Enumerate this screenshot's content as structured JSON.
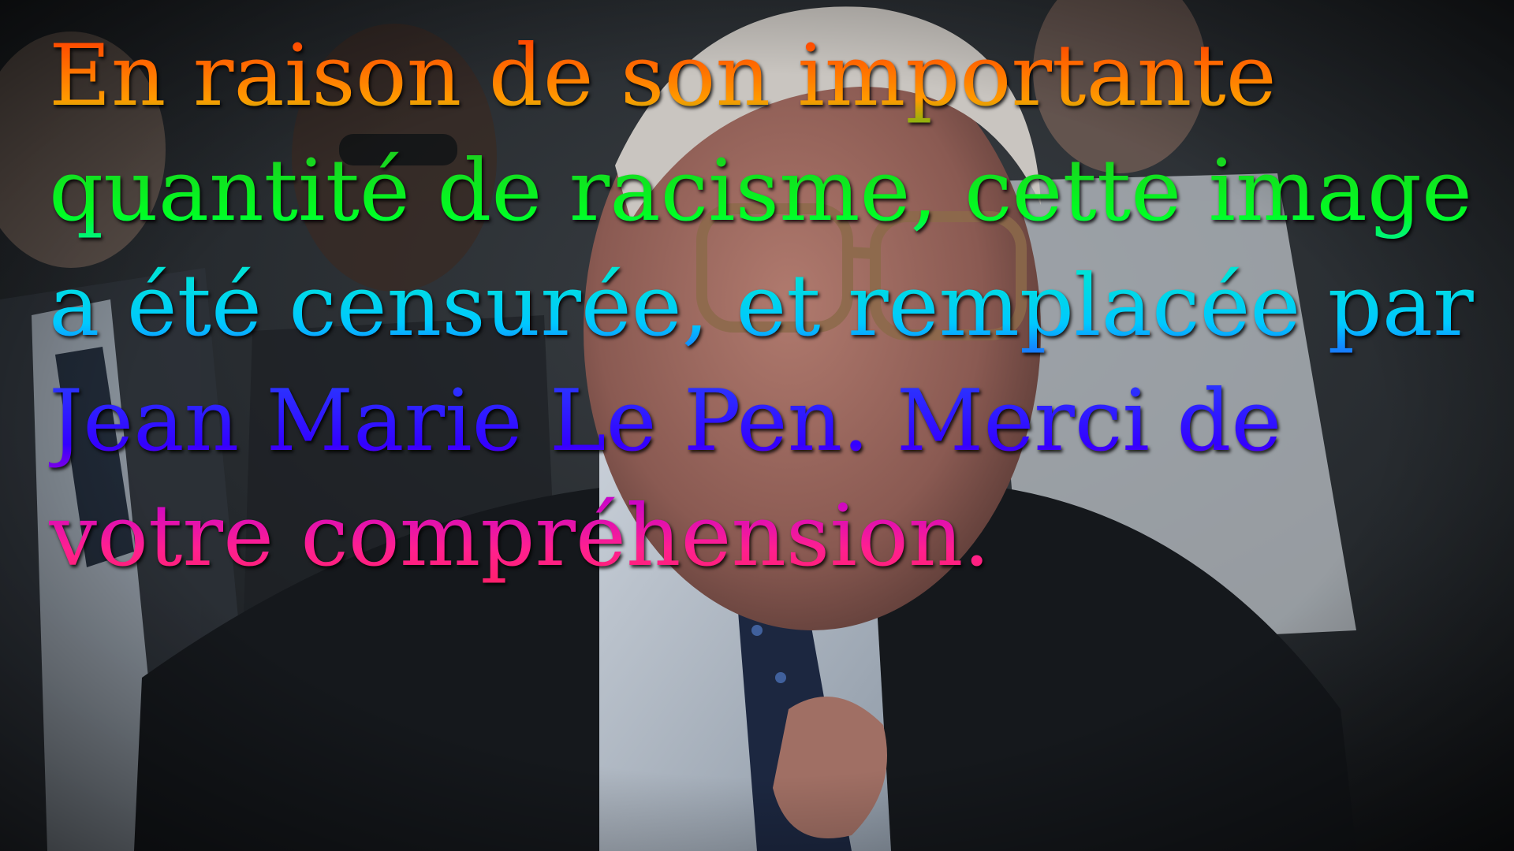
{
  "caption": {
    "text": "En raison de son importante quantité de racisme, cette image a été censurée, et remplacée par Jean Marie Le Pen. Merci de votre compréhension."
  },
  "colors": {
    "gradient": [
      "#ff2a00",
      "#ff9a00",
      "#00ff22",
      "#00e8d0",
      "#2a3cff",
      "#3300ff",
      "#ff2090"
    ]
  }
}
